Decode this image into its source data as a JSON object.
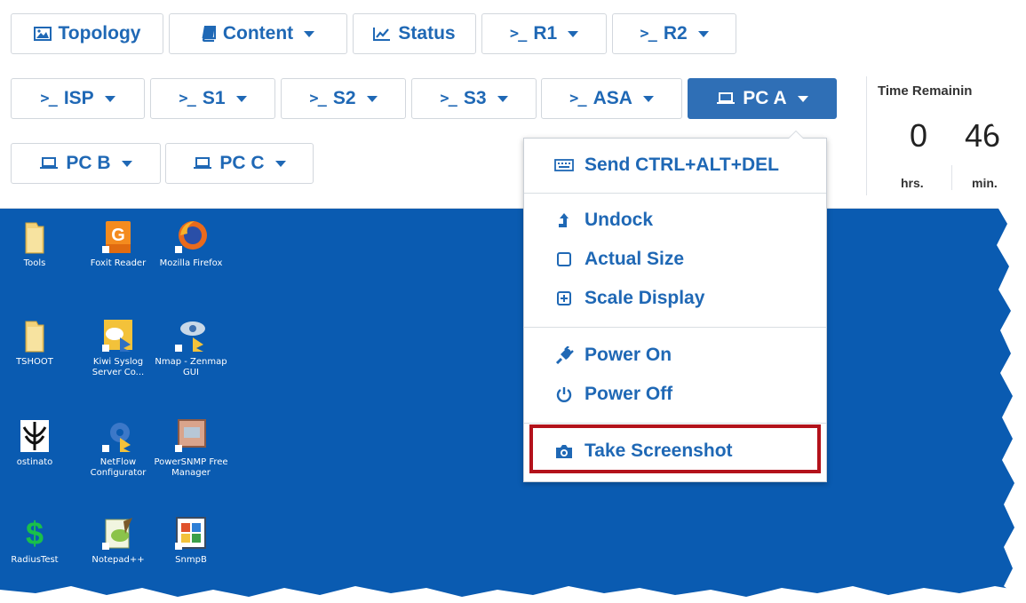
{
  "toolbar": {
    "row1": [
      {
        "label": "Topology",
        "icon": "image-icon"
      },
      {
        "label": "Content",
        "icon": "book-icon",
        "dropdown": true
      },
      {
        "label": "Status",
        "icon": "line-chart-icon"
      },
      {
        "label": "R1",
        "icon": "terminal-icon",
        "dropdown": true
      },
      {
        "label": "R2",
        "icon": "terminal-icon",
        "dropdown": true
      }
    ],
    "row2": [
      {
        "label": "ISP",
        "icon": "terminal-icon",
        "dropdown": true
      },
      {
        "label": "S1",
        "icon": "terminal-icon",
        "dropdown": true
      },
      {
        "label": "S2",
        "icon": "terminal-icon",
        "dropdown": true
      },
      {
        "label": "S3",
        "icon": "terminal-icon",
        "dropdown": true
      },
      {
        "label": "ASA",
        "icon": "terminal-icon",
        "dropdown": true
      },
      {
        "label": "PC A",
        "icon": "laptop-icon",
        "dropdown": true,
        "active": true
      }
    ],
    "row3": [
      {
        "label": "PC B",
        "icon": "laptop-icon",
        "dropdown": true
      },
      {
        "label": "PC C",
        "icon": "laptop-icon",
        "dropdown": true
      }
    ],
    "prompt_glyph": ">_"
  },
  "timer": {
    "label": "Time Remainin",
    "hours": "0",
    "minutes": "46",
    "hours_unit": "hrs.",
    "minutes_unit": "min."
  },
  "menu": {
    "groups": [
      [
        {
          "label": "Send CTRL+ALT+DEL",
          "icon": "keyboard-icon"
        }
      ],
      [
        {
          "label": "Undock",
          "icon": "undock-icon"
        },
        {
          "label": "Actual Size",
          "icon": "square-icon"
        },
        {
          "label": "Scale Display",
          "icon": "plus-square-icon"
        }
      ],
      [
        {
          "label": "Power On",
          "icon": "plug-icon"
        },
        {
          "label": "Power Off",
          "icon": "power-icon"
        }
      ],
      [
        {
          "label": "Take Screenshot",
          "icon": "camera-icon"
        }
      ]
    ]
  },
  "desktop": {
    "icons": [
      {
        "caption": "Tools",
        "icon": "folder-icon"
      },
      {
        "caption": "Foxit Reader",
        "icon": "foxit-pdf-icon"
      },
      {
        "caption": "Mozilla Firefox",
        "icon": "firefox-icon"
      },
      {
        "caption": "TSHOOT",
        "icon": "folder-icon"
      },
      {
        "caption": "Kiwi Syslog Server Co...",
        "icon": "kiwi-syslog-icon"
      },
      {
        "caption": "Nmap - Zenmap GUI",
        "icon": "zenmap-icon"
      },
      {
        "caption": "ostinato",
        "icon": "ostinato-icon"
      },
      {
        "caption": "NetFlow Configurator",
        "icon": "netflow-icon"
      },
      {
        "caption": "PowerSNMP Free Manager",
        "icon": "powersnmp-icon"
      },
      {
        "caption": "RadiusTest",
        "icon": "radiustest-icon"
      },
      {
        "caption": "Notepad++",
        "icon": "notepadpp-icon"
      },
      {
        "caption": "SnmpB",
        "icon": "snmpb-icon"
      }
    ]
  },
  "colors": {
    "accent": "#1f68b5",
    "active_button": "#2f6fb6",
    "desktop_bg": "#0a5bb1",
    "highlight_border": "#b3121b"
  }
}
